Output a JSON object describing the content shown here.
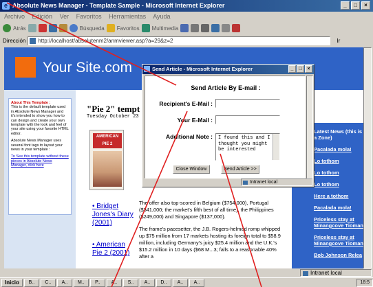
{
  "window": {
    "title": "Absolute News Manager - Template Sample - Microsoft Internet Explorer",
    "controls": [
      "_",
      "□",
      "×"
    ]
  },
  "menubar": [
    "Archivo",
    "Edición",
    "Ver",
    "Favoritos",
    "Herramientas",
    "Ayuda"
  ],
  "toolbar": {
    "back_label": "Atrás",
    "search_label": "Búsqueda",
    "favorites_label": "Favoritos",
    "multimedia_label": "Multimedia"
  },
  "address": {
    "label": "Dirección",
    "url": "http://localhost/absolutenm2/anmviewer.asp?a=29&z=2",
    "go_label": "Ir"
  },
  "site": {
    "title": "Your Site.com",
    "brand_color": "#2f63c6",
    "logo_color": "#f26c0d"
  },
  "sidebar": {
    "about_heading": "About This Template :",
    "about_text": "This is the default template used in Absolute News Manager and it's intended to show you how to can design and create your own template with the look and feel of your site using your favorite HTML editor.",
    "about_text2": "Absolute News Manager uses several font tags to layout your news in your template :",
    "link_text": "To See this template without these pieces in Absolute News Manager, click here"
  },
  "article": {
    "title": "\"Pie 2\" tempt",
    "date": "Tuesday October 23",
    "poster_title": "AMERICAN PIE 2",
    "related_links": [
      "Bridget Jones's Diary (2001)",
      "American Pie 2 (2001)"
    ],
    "paragraphs": [
      "The offer also top-scored in Belgium ($754,000), Portugal ($341,000; the market's fifth best of all time), the Philippines ($249,000) and Singapore ($137,000).",
      "The frame's pacesetter, the J.B. Rogers-helmed romp whipped up $75 million from 17 markets hosting its foreign total to $58.9 million, including Germany's juicy $25.4 million and the U.K.'s $15.2 million in 10 days ($68 M...3; falls to a reasonable 40% after a"
    ]
  },
  "latest_news": {
    "heading": "Latest News (this is a Zone)",
    "items": [
      "Pacalada mola!",
      "Lo tothom",
      "Lo tothom",
      "Lo tothom",
      "Here a tothom",
      "Pacalada mola!",
      "Priceless stay at Minangcove Tioman",
      "Priceless stay at Minangcove Tioman",
      "Bob Johnson Relea"
    ]
  },
  "popup": {
    "title": "Send Article - Microsoft Internet Explorer",
    "heading": "Send Article By E-mail :",
    "recipient_label": "Recipient's E-Mail :",
    "recipient_value": "",
    "your_label": "Your E-Mail :",
    "your_value": "",
    "note_label": "Additional Note :",
    "note_value": "I found this and I thought you might be interested",
    "close_label": "Close Window",
    "send_label": "Send Article >>",
    "zone_label": "Intranet local"
  },
  "statusbar": {
    "zone_label": "Intranet local"
  },
  "taskbar": {
    "start_label": "Inicio",
    "clock": "18:5",
    "buttons": [
      "B..",
      "C..",
      "A..",
      "M..",
      "P..",
      "A..",
      "S..",
      "A..",
      "D..",
      "A..",
      "A.."
    ]
  },
  "annotation_color": "#e02020"
}
